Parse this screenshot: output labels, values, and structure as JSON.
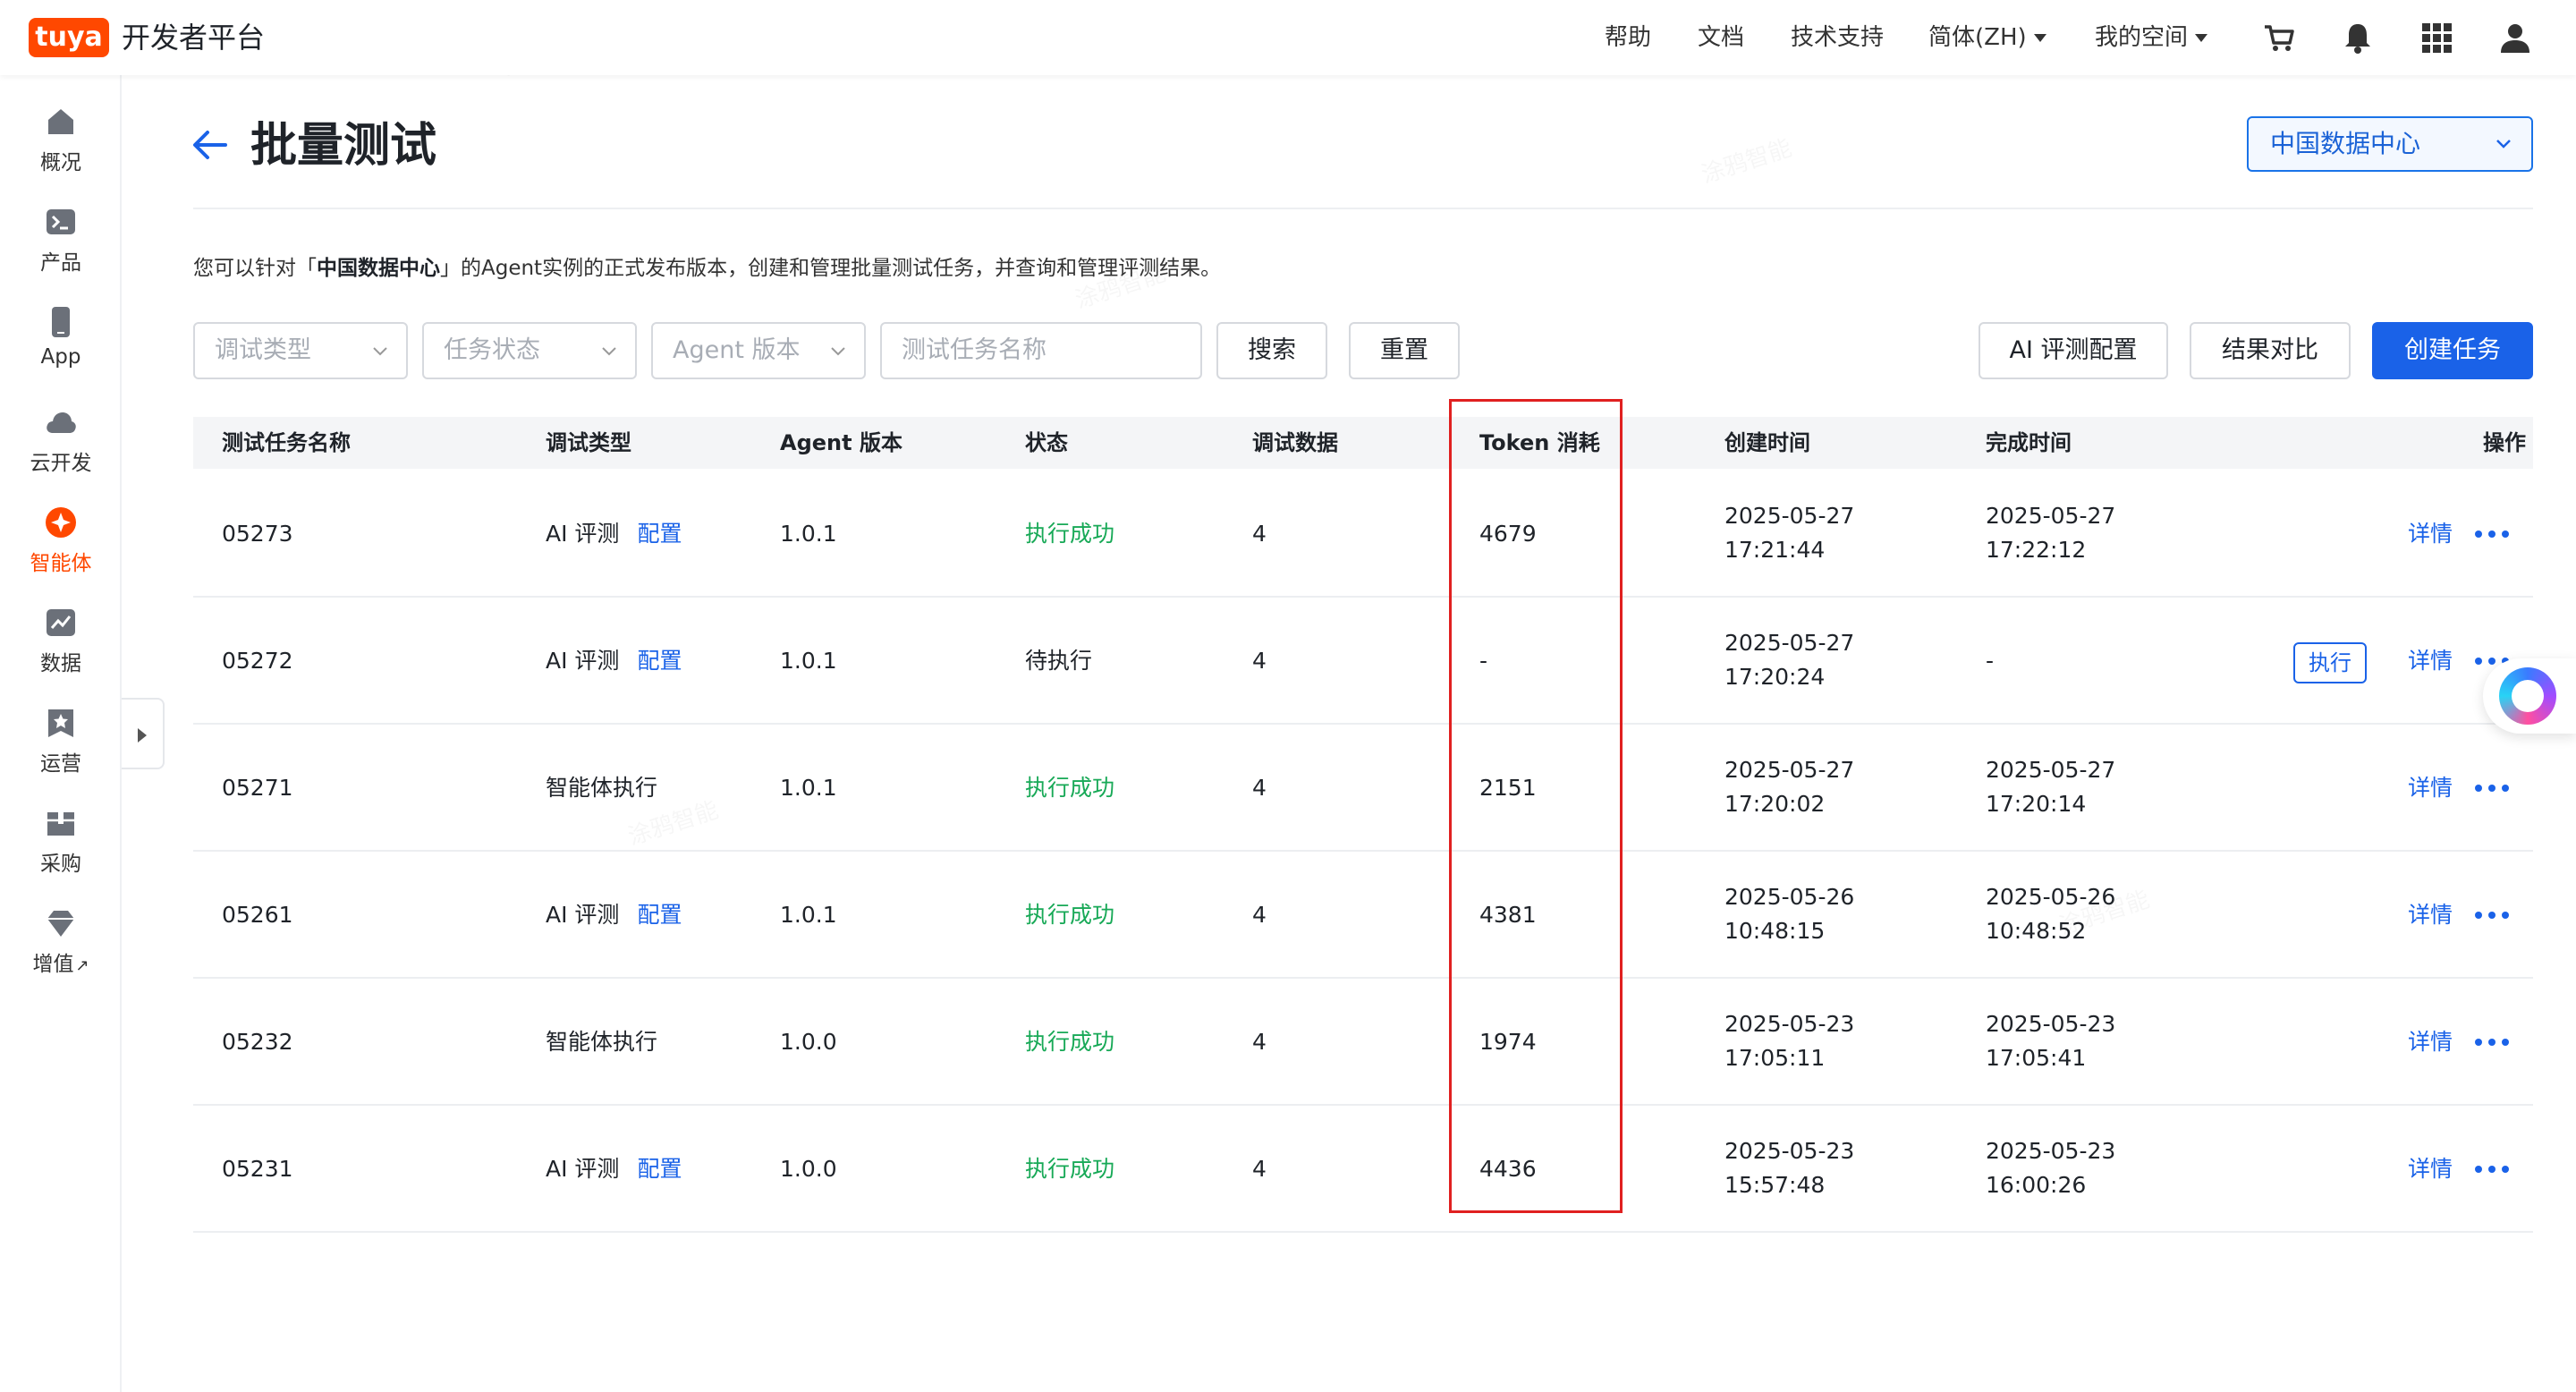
{
  "topbar": {
    "logo": "tuya",
    "brand": "开发者平台",
    "nav": [
      "帮助",
      "文档",
      "技术支持",
      "简体(ZH)",
      "我的空间"
    ],
    "icons": [
      "cart-icon",
      "bell-icon",
      "grid-icon",
      "user-icon"
    ]
  },
  "sidebar": {
    "items": [
      {
        "label": "概况",
        "icon": "home-icon"
      },
      {
        "label": "产品",
        "icon": "terminal-icon"
      },
      {
        "label": "App",
        "icon": "phone-icon"
      },
      {
        "label": "云开发",
        "icon": "cloud-icon"
      },
      {
        "label": "智能体",
        "icon": "sparkle-icon",
        "active": true
      },
      {
        "label": "数据",
        "icon": "chart-icon"
      },
      {
        "label": "运营",
        "icon": "star-bookmark-icon"
      },
      {
        "label": "采购",
        "icon": "box-icon"
      },
      {
        "label": "增值",
        "icon": "gem-icon"
      }
    ],
    "external_mark": "↗"
  },
  "header": {
    "title": "批量测试",
    "region": "中国数据中心",
    "description_prefix": "您可以针对「",
    "description_region": "中国数据中心",
    "description_suffix": "」的Agent实例的正式发布版本，创建和管理批量测试任务，并查询和管理评测结果。"
  },
  "filters": {
    "debug_type_placeholder": "调试类型",
    "task_status_placeholder": "任务状态",
    "agent_version_placeholder": "Agent 版本",
    "task_name_placeholder": "测试任务名称",
    "search_label": "搜索",
    "reset_label": "重置",
    "ai_config_label": "AI 评测配置",
    "compare_label": "结果对比",
    "create_label": "创建任务"
  },
  "table": {
    "columns": {
      "name": "测试任务名称",
      "type": "调试类型",
      "version": "Agent 版本",
      "status": "状态",
      "data": "调试数据",
      "tokens": "Token 消耗",
      "created": "创建时间",
      "finished": "完成时间",
      "actions": "操作"
    },
    "config_link": "配置",
    "detail_link": "详情",
    "execute_label": "执行",
    "rows": [
      {
        "name": "05273",
        "type": "AI 评测",
        "has_config": true,
        "version": "1.0.1",
        "status": "执行成功",
        "status_kind": "ok",
        "data": "4",
        "tokens": "4679",
        "created_date": "2025-05-27",
        "created_time": "17:21:44",
        "finished_date": "2025-05-27",
        "finished_time": "17:22:12"
      },
      {
        "name": "05272",
        "type": "AI 评测",
        "has_config": true,
        "version": "1.0.1",
        "status": "待执行",
        "status_kind": "wait",
        "data": "4",
        "tokens": "-",
        "created_date": "2025-05-27",
        "created_time": "17:20:24",
        "finished_date": "-",
        "finished_time": "",
        "can_execute": true
      },
      {
        "name": "05271",
        "type": "智能体执行",
        "has_config": false,
        "version": "1.0.1",
        "status": "执行成功",
        "status_kind": "ok",
        "data": "4",
        "tokens": "2151",
        "created_date": "2025-05-27",
        "created_time": "17:20:02",
        "finished_date": "2025-05-27",
        "finished_time": "17:20:14"
      },
      {
        "name": "05261",
        "type": "AI 评测",
        "has_config": true,
        "version": "1.0.1",
        "status": "执行成功",
        "status_kind": "ok",
        "data": "4",
        "tokens": "4381",
        "created_date": "2025-05-26",
        "created_time": "10:48:15",
        "finished_date": "2025-05-26",
        "finished_time": "10:48:52"
      },
      {
        "name": "05232",
        "type": "智能体执行",
        "has_config": false,
        "version": "1.0.0",
        "status": "执行成功",
        "status_kind": "ok",
        "data": "4",
        "tokens": "1974",
        "created_date": "2025-05-23",
        "created_time": "17:05:11",
        "finished_date": "2025-05-23",
        "finished_time": "17:05:41"
      },
      {
        "name": "05231",
        "type": "AI 评测",
        "has_config": true,
        "version": "1.0.0",
        "status": "执行成功",
        "status_kind": "ok",
        "data": "4",
        "tokens": "4436",
        "created_date": "2025-05-23",
        "created_time": "15:57:48",
        "finished_date": "2025-05-23",
        "finished_time": "16:00:26"
      }
    ]
  },
  "colors": {
    "brand_orange": "#ff4800",
    "primary_blue": "#1a62e8",
    "success_green": "#18a957",
    "highlight_red": "#e02020"
  }
}
